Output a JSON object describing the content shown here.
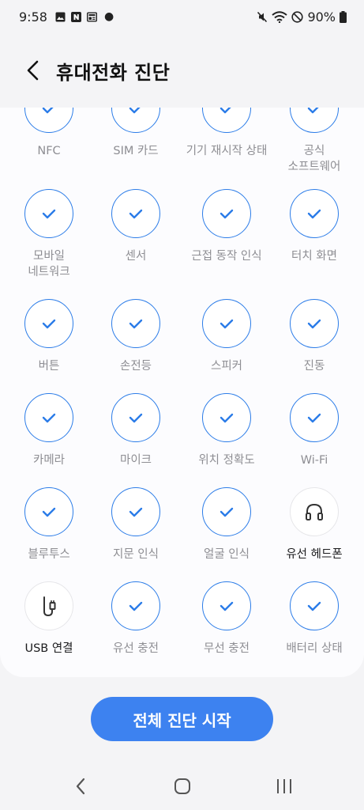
{
  "status_bar": {
    "time": "9:58",
    "battery": "90%",
    "icons": [
      "gallery-icon",
      "naver-icon",
      "news-icon",
      "mute-icon",
      "wifi-icon",
      "dnd-icon",
      "battery-icon"
    ]
  },
  "header": {
    "title": "휴대전화 진단",
    "back_icon": "chevron-left-icon"
  },
  "accent_color": "#2b7ce8",
  "grid": {
    "rows": [
      [
        {
          "label": "NFC",
          "state": "checked"
        },
        {
          "label": "SIM 카드",
          "state": "checked"
        },
        {
          "label": "기기 재시작 상태",
          "state": "checked"
        },
        {
          "label": "공식\n소프트웨어",
          "state": "checked"
        }
      ],
      [
        {
          "label": "모바일\n네트워크",
          "state": "checked"
        },
        {
          "label": "센서",
          "state": "checked"
        },
        {
          "label": "근접 동작 인식",
          "state": "checked"
        },
        {
          "label": "터치 화면",
          "state": "checked"
        }
      ],
      [
        {
          "label": "버튼",
          "state": "checked"
        },
        {
          "label": "손전등",
          "state": "checked"
        },
        {
          "label": "스피커",
          "state": "checked"
        },
        {
          "label": "진동",
          "state": "checked"
        }
      ],
      [
        {
          "label": "카메라",
          "state": "checked"
        },
        {
          "label": "마이크",
          "state": "checked"
        },
        {
          "label": "위치 정확도",
          "state": "checked"
        },
        {
          "label": "Wi-Fi",
          "state": "checked"
        }
      ],
      [
        {
          "label": "블루투스",
          "state": "checked"
        },
        {
          "label": "지문 인식",
          "state": "checked"
        },
        {
          "label": "얼굴 인식",
          "state": "checked"
        },
        {
          "label": "유선 헤드폰",
          "state": "untested",
          "icon": "headphones-icon"
        }
      ],
      [
        {
          "label": "USB 연결",
          "state": "untested",
          "icon": "usb-cable-icon"
        },
        {
          "label": "유선 충전",
          "state": "checked"
        },
        {
          "label": "무선 충전",
          "state": "checked"
        },
        {
          "label": "배터리 상태",
          "state": "checked"
        }
      ]
    ]
  },
  "start_button": {
    "label": "전체 진단 시작",
    "color": "#3d82f0"
  },
  "nav_bar": {
    "buttons": [
      "back-icon",
      "home-icon",
      "recents-icon"
    ]
  }
}
